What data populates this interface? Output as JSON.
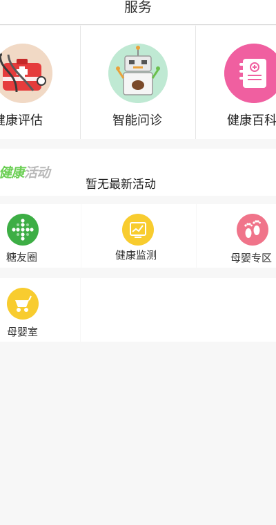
{
  "header": {
    "title": "服务"
  },
  "services": [
    {
      "label": "健康评估",
      "icon": "first-aid-kit-icon"
    },
    {
      "label": "智能问诊",
      "icon": "robot-doctor-icon"
    },
    {
      "label": "健康百科",
      "icon": "medical-book-icon"
    }
  ],
  "activity": {
    "logo_part1": "健康",
    "logo_part2": "活动",
    "empty_text": "暂无最新活动"
  },
  "grid": [
    {
      "label": "糖友圈",
      "icon": "plus-cross-icon",
      "color": "#3dae45"
    },
    {
      "label": "健康监测",
      "icon": "monitor-chart-icon",
      "color": "#f8cc2f"
    },
    {
      "label": "母婴专区",
      "icon": "baby-feet-icon",
      "color": "#f0748a"
    },
    {
      "label": "母婴室",
      "icon": "baby-stroller-icon",
      "color": "#f8cc2f"
    }
  ]
}
